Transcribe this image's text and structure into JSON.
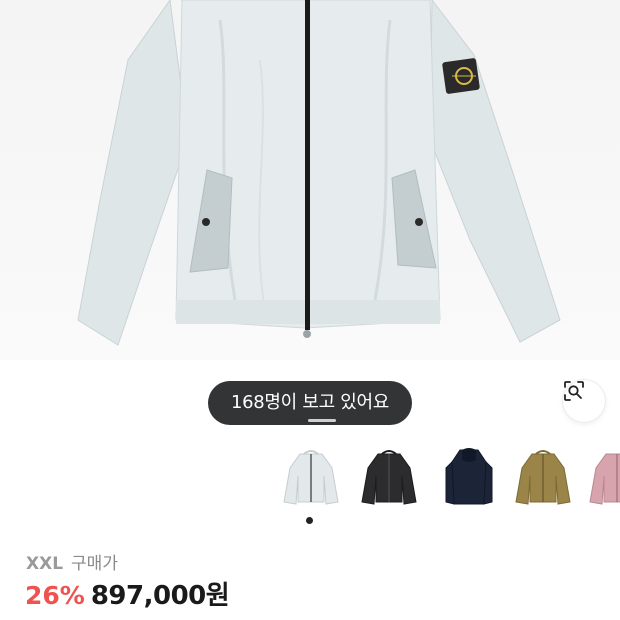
{
  "product": {
    "image_icon": "jacket-photo",
    "viewers_text": "168명이 보고 있어요",
    "lens_icon": "image-search-icon",
    "thumbnails": [
      {
        "icon": "jacket-thumbnail",
        "color": "#e3e9ea",
        "selected": true
      },
      {
        "icon": "jacket-thumbnail",
        "color": "#2c2c2e",
        "selected": false
      },
      {
        "icon": "jacket-thumbnail",
        "color": "#1c2537",
        "selected": false
      },
      {
        "icon": "jacket-thumbnail",
        "color": "#9b8447",
        "selected": false
      },
      {
        "icon": "jacket-thumbnail",
        "color": "#d7a4ad",
        "selected": false
      }
    ],
    "image_pager": {
      "current": 1
    }
  },
  "purchase": {
    "size": "XXL",
    "label": "구매가",
    "discount": "26%",
    "price": "897,000원"
  }
}
